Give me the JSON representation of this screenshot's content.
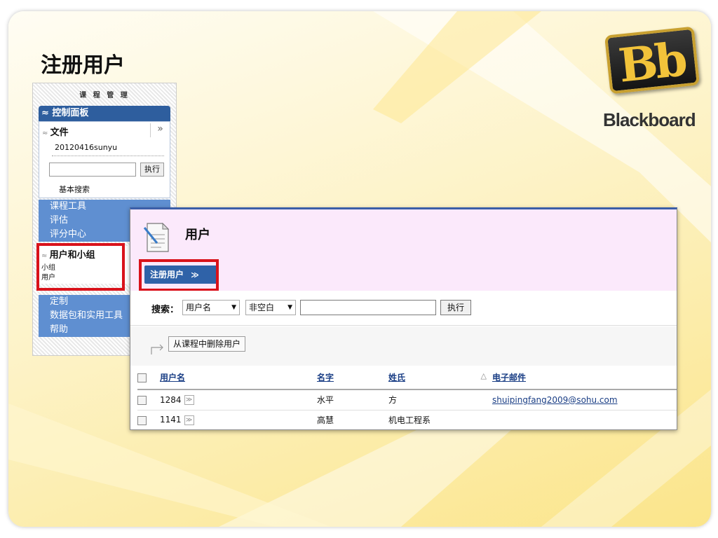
{
  "slide": {
    "title": "注册用户"
  },
  "logo": {
    "letters": "Bb",
    "word": "Blackboard"
  },
  "menu": {
    "header": "课 程 管 理",
    "panel_title": "控制面板",
    "files": {
      "title": "文件",
      "expand": "»",
      "item": "20120416sunyu",
      "go_label": "执行",
      "basic_search": "基本搜索"
    },
    "groups_top": [
      "课程工具",
      "评估",
      "评分中心"
    ],
    "active": {
      "title": "用户和小组",
      "sub1": "小组",
      "sub2": "用户"
    },
    "groups_bottom": [
      "定制",
      "数据包和实用工具",
      "帮助"
    ]
  },
  "main": {
    "title": "用户",
    "register_button": "注册用户",
    "search": {
      "label": "搜索：",
      "field_select": "用户名",
      "op_select": "非空白",
      "input_value": "",
      "go_label": "执行"
    },
    "remove_button": "从课程中删除用户",
    "columns": {
      "username": "用户名",
      "firstname": "名字",
      "lastname": "姓氏",
      "email": "电子邮件"
    },
    "rows": [
      {
        "username": "1284",
        "firstname": "水平",
        "lastname": "方",
        "email": "shuipingfang2009@sohu.com"
      },
      {
        "username": "1141",
        "firstname": "高慧",
        "lastname": "机电工程系",
        "email": ""
      }
    ]
  }
}
